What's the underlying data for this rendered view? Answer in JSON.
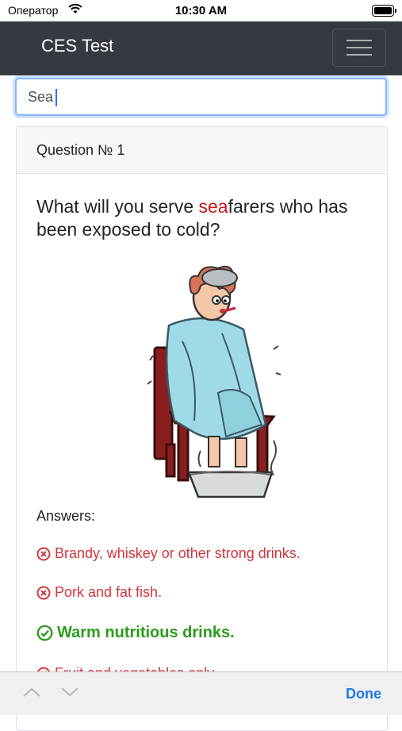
{
  "status_bar": {
    "carrier": "Оператор",
    "time": "10:30 AM"
  },
  "navbar": {
    "brand": "CES Test"
  },
  "search": {
    "value": "Sea"
  },
  "card": {
    "header": "Question № 1",
    "question_highlight": "sea",
    "question_rest": "farers who has been exposed to cold?",
    "question_prefix": "What will you serve ",
    "answers_label": "Answers:",
    "answers": [
      {
        "text": "Brandy, whiskey or other strong drinks.",
        "correct": false
      },
      {
        "text": "Pork and fat fish.",
        "correct": false
      },
      {
        "text": "Warm nutritious drinks.",
        "correct": true
      },
      {
        "text": "Fruit and vegetables only.",
        "correct": false
      }
    ]
  },
  "toolbar": {
    "done_label": "Done"
  },
  "colors": {
    "navbar": "#343a40",
    "highlight": "#c0161d",
    "wrong": "#d0373f",
    "correct": "#2a9c1a",
    "done": "#1f7ae0"
  }
}
